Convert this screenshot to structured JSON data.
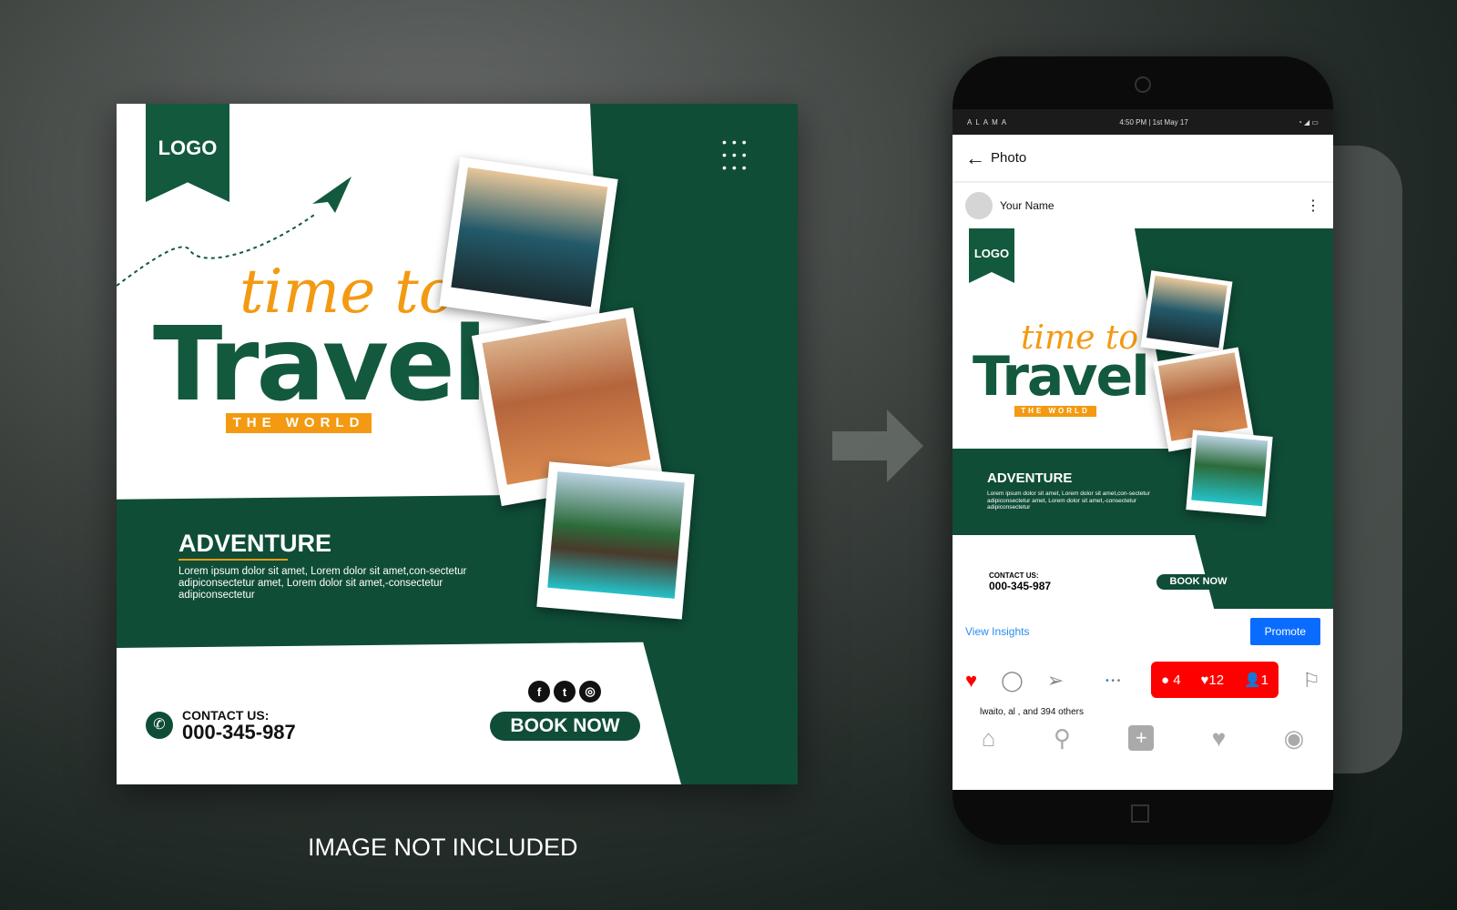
{
  "post": {
    "logo": "LOGO",
    "headline_script": "time to",
    "headline_main": "Travel",
    "tagline": "THE WORLD",
    "section_title": "ADVENTURE",
    "body": "Lorem ipsum dolor sit amet, Lorem dolor sit amet,con-sectetur adipiconsectetur amet, Lorem dolor sit amet,-consectetur adipiconsectetur",
    "contact_label": "CONTACT US:",
    "contact_phone": "000-345-987",
    "cta": "BOOK NOW",
    "social_icons": [
      "facebook-icon",
      "twitter-icon",
      "instagram-icon"
    ],
    "colors": {
      "green": "#0f4d37",
      "orange": "#f39a12"
    }
  },
  "caption": "IMAGE NOT INCLUDED",
  "phone": {
    "status": {
      "carrier": "ALAMA",
      "time": "4:50 PM | 1st May 17"
    },
    "header_title": "Photo",
    "username": "Your Name",
    "view_insights": "View Insights",
    "promote": "Promote",
    "likes_text": "lwaito, al , and 394 others",
    "notification": {
      "comments": "4",
      "likes": "12",
      "followers": "1"
    },
    "colors": {
      "blue": "#0a6cff",
      "red": "#ff0000"
    }
  }
}
